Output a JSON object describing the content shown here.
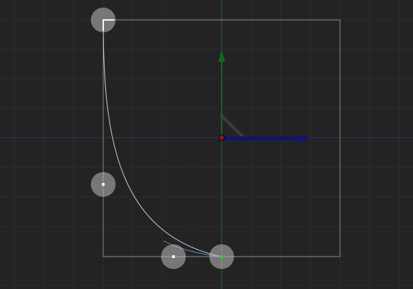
{
  "viewport": {
    "name": "3d-viewport",
    "mode": "curve-edit"
  },
  "colors": {
    "background": "#232323",
    "grid": "#2c2c2c",
    "axis_x": "#2b2b6b",
    "axis_y": "#1f6a2a",
    "frame": "#8a8a8a",
    "curve": "#d6d6d6",
    "curve_handle": "#5b8fc7",
    "handle_fill": "#bdbdbd",
    "x_arrow": "#14146a",
    "y_arrow": "#0f6a1f",
    "origin": "#7a1e1e"
  },
  "icons": {
    "move_x": "arrow-right-icon",
    "move_y": "arrow-up-icon",
    "origin": "pivot-point-icon",
    "control_point": "circle-handle-icon"
  },
  "control_points": [
    {
      "id": "top-left",
      "role": "curve-start"
    },
    {
      "id": "mid-left",
      "role": "tangent-handle"
    },
    {
      "id": "bottom-mid",
      "role": "tangent-handle"
    },
    {
      "id": "bottom-right",
      "role": "curve-end"
    }
  ]
}
